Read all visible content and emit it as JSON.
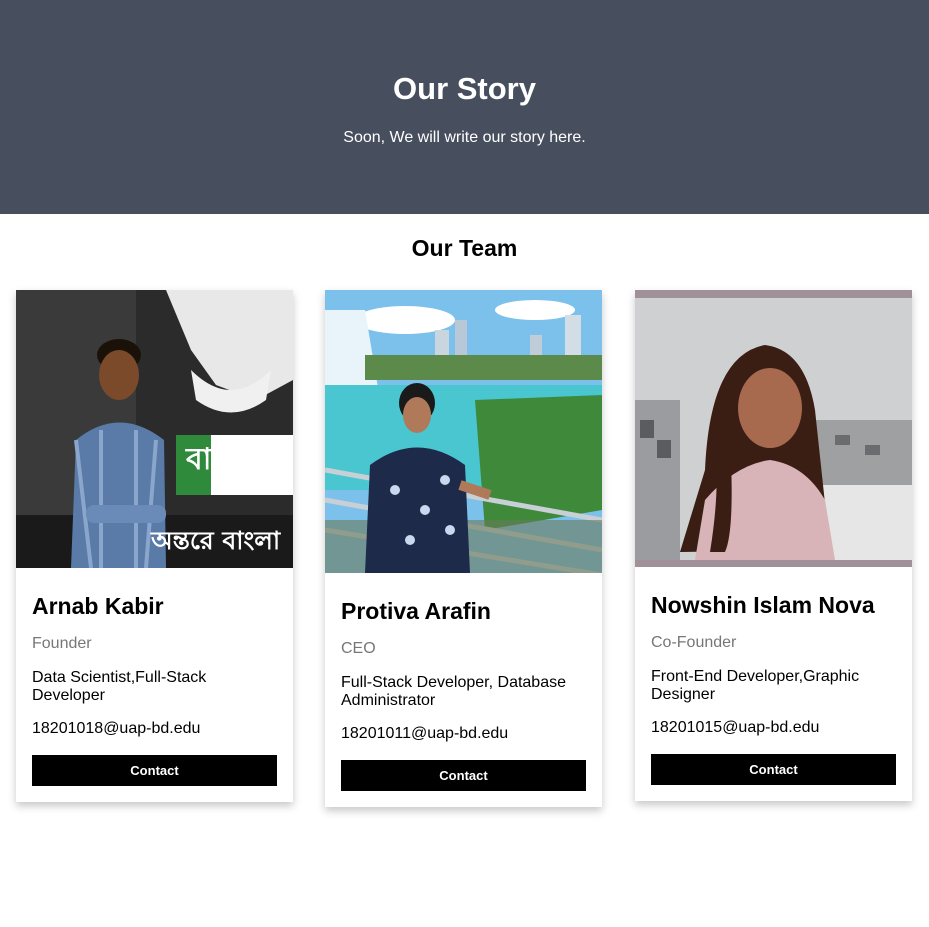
{
  "hero": {
    "title": "Our Story",
    "subtitle": "Soon, We will write our story here."
  },
  "team": {
    "title": "Our Team",
    "members": [
      {
        "name": "Arnab Kabir",
        "role": "Founder",
        "description": "Data Scientist,Full-Stack Developer",
        "email": "18201018@uap-bd.edu",
        "contact_label": "Contact",
        "photo_sign_text": "বাংলা",
        "photo_banner_text": "অন্তরে বাংলা"
      },
      {
        "name": "Protiva Arafin",
        "role": "CEO",
        "description": "Full-Stack Developer, Database Administrator",
        "email": "18201011@uap-bd.edu",
        "contact_label": "Contact"
      },
      {
        "name": "Nowshin Islam Nova",
        "role": "Co-Founder",
        "description": "Front-End Developer,Graphic Designer",
        "email": "18201015@uap-bd.edu",
        "contact_label": "Contact"
      }
    ]
  },
  "colors": {
    "hero_background": "#474e5d",
    "button_background": "#000000",
    "role_text": "#777777"
  }
}
